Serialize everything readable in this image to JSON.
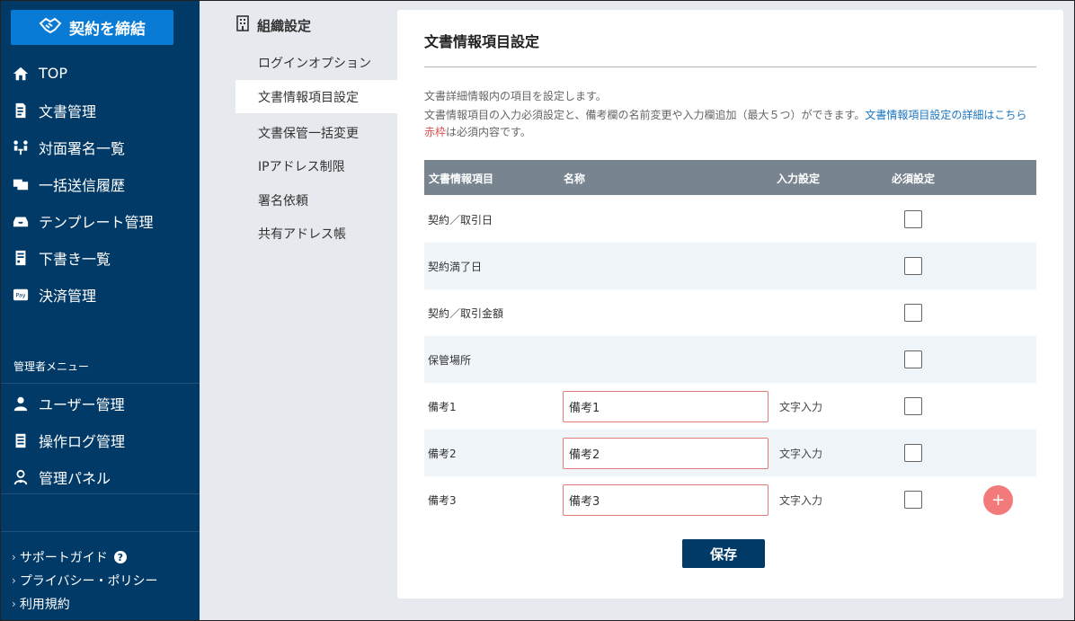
{
  "sidebar": {
    "brand_label": "契約を締結",
    "nav": [
      {
        "label": "TOP",
        "icon": "home-icon"
      },
      {
        "label": "文書管理",
        "icon": "document-icon"
      },
      {
        "label": "対面署名一覧",
        "icon": "face-sign-icon"
      },
      {
        "label": "一括送信履歴",
        "icon": "bulk-send-icon"
      },
      {
        "label": "テンプレート管理",
        "icon": "template-icon"
      },
      {
        "label": "下書き一覧",
        "icon": "draft-icon"
      },
      {
        "label": "決済管理",
        "icon": "payment-icon"
      }
    ],
    "admin_title": "管理者メニュー",
    "admin_nav": [
      {
        "label": "ユーザー管理",
        "icon": "user-icon"
      },
      {
        "label": "操作ログ管理",
        "icon": "log-icon"
      },
      {
        "label": "管理パネル",
        "icon": "admin-panel-icon"
      }
    ],
    "footer": [
      {
        "label": "サポートガイド"
      },
      {
        "label": "プライバシー・ポリシー"
      },
      {
        "label": "利用規約"
      }
    ]
  },
  "submenu": {
    "title": "組織設定",
    "items": [
      {
        "label": "ログインオプション"
      },
      {
        "label": "文書情報項目設定"
      },
      {
        "label": "文書保管一括変更"
      },
      {
        "label": "IPアドレス制限"
      },
      {
        "label": "署名依頼"
      },
      {
        "label": "共有アドレス帳"
      }
    ]
  },
  "main": {
    "title": "文書情報項目設定",
    "desc_line1": "文書詳細情報内の項目を設定します。",
    "desc_line2": "文書情報項目の入力必須設定と、備考欄の名前変更や入力欄追加（最大５つ）ができます。",
    "desc_link": "文書情報項目設定の詳細はこちら",
    "desc_red": "赤枠",
    "desc_line3_rest": "は必須内容です。",
    "headers": {
      "item": "文書情報項目",
      "name": "名称",
      "input": "入力設定",
      "required": "必須設定"
    },
    "rows": [
      {
        "label": "契約／取引日"
      },
      {
        "label": "契約満了日"
      },
      {
        "label": "契約／取引金額"
      },
      {
        "label": "保管場所"
      },
      {
        "label": "備考1",
        "name_value": "備考1",
        "input_type": "文字入力"
      },
      {
        "label": "備考2",
        "name_value": "備考2",
        "input_type": "文字入力"
      },
      {
        "label": "備考3",
        "name_value": "備考3",
        "input_type": "文字入力"
      }
    ],
    "add_label": "+",
    "save_label": "保存"
  }
}
